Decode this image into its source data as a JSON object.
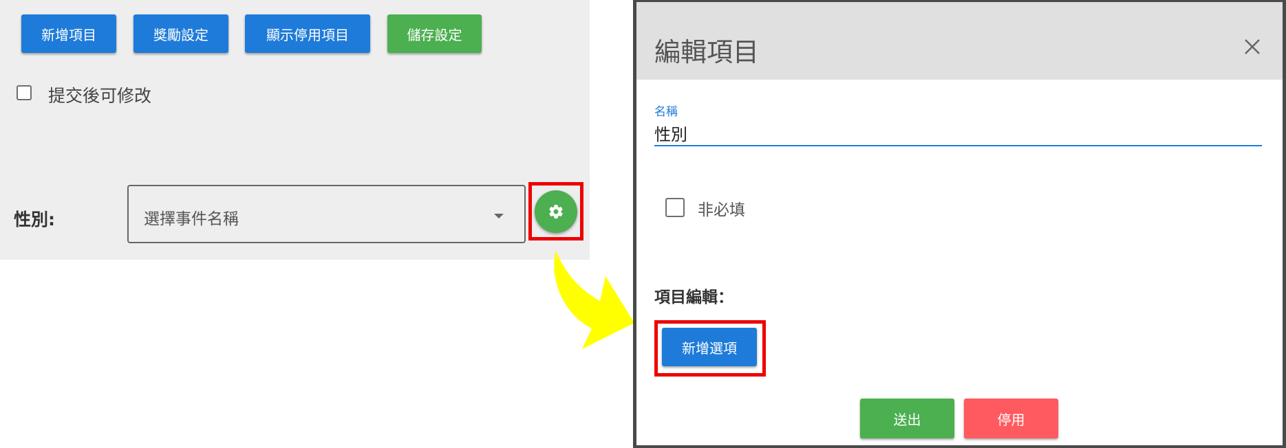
{
  "toolbar": {
    "add_item": "新增項目",
    "reward_settings": "獎勵設定",
    "show_disabled": "顯示停用項目",
    "save_settings": "儲存設定"
  },
  "form": {
    "editable_after_submit": "提交後可修改",
    "field_label": "性別:",
    "event_select_placeholder": "選擇事件名稱"
  },
  "dialog": {
    "title": "編輯項目",
    "name_label": "名稱",
    "name_value": "性別",
    "optional_label": "非必填",
    "item_edit_label": "項目編輯：",
    "add_option": "新增選項",
    "submit": "送出",
    "disable": "停用"
  },
  "colors": {
    "primary_blue": "#1e7bd9",
    "success_green": "#4caf50",
    "danger_red": "#ff5a5f",
    "highlight_red": "#ee0000",
    "arrow_yellow": "#ffff00"
  },
  "icons": [
    "gear-icon",
    "close-icon",
    "dropdown-arrow-icon",
    "yellow-arrow-icon"
  ]
}
